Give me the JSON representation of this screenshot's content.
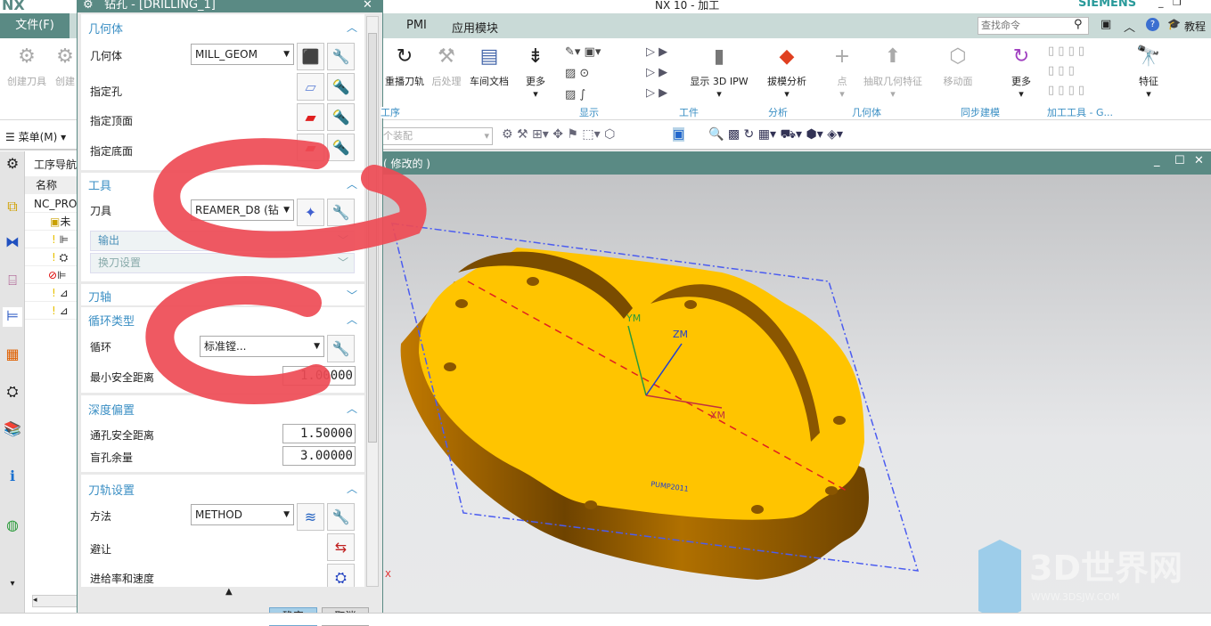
{
  "app": {
    "title": "NX 10 - 加工",
    "brand": "SIEMENS",
    "logo": "NX"
  },
  "menu": {
    "file": "文件(F)",
    "tabs": [
      "PMI",
      "应用模块"
    ],
    "search_placeholder": "查找命令",
    "tutorial": "教程",
    "menu_btn": "菜单(M)"
  },
  "ribbon": {
    "left_buttons": [
      "创建刀具",
      "创建"
    ],
    "buttons": [
      {
        "label": "重播刀轨",
        "icon": "replay-icon",
        "enabled": true
      },
      {
        "label": "后处理",
        "icon": "postprocess-icon",
        "enabled": false
      },
      {
        "label": "车间文档",
        "icon": "shop-doc-icon",
        "enabled": true
      },
      {
        "label": "更多",
        "icon": "more-icon",
        "enabled": true
      },
      {
        "label": "显示 3D IPW",
        "icon": "ipw-icon",
        "enabled": true
      },
      {
        "label": "拔模分析",
        "icon": "draft-analysis-icon",
        "enabled": true
      },
      {
        "label": "点",
        "icon": "point-icon",
        "enabled": false
      },
      {
        "label": "抽取几何特征",
        "icon": "extract-geometry-icon",
        "enabled": false
      },
      {
        "label": "移动面",
        "icon": "move-face-icon",
        "enabled": false
      },
      {
        "label": "更多",
        "icon": "more-icon",
        "enabled": true
      },
      {
        "label": "特征",
        "icon": "feature-icon",
        "enabled": true
      }
    ],
    "groups": [
      "工序",
      "显示",
      "工件",
      "分析",
      "几何体",
      "同步建模",
      "加工工具 - G..."
    ]
  },
  "toolbar": {
    "assembly_placeholder": "个装配"
  },
  "viewport": {
    "title": "( 修改的 )",
    "axes": {
      "x": "XM",
      "y": "YM",
      "z": "ZM"
    },
    "part_text": "PUMP2011",
    "corner_axis": "X",
    "watermark": {
      "name": "3D世界网",
      "url": "WWW.3DSJW.COM"
    }
  },
  "nav": {
    "title": "工序导航",
    "col_name": "名称",
    "root": "NC_PROGRAM",
    "rows": [
      "未",
      "",
      "",
      "",
      ""
    ]
  },
  "dialog": {
    "title": "钻孔 - [DRILLING_1]",
    "sections": {
      "geometry": {
        "title": "几何体",
        "geometry_label": "几何体",
        "geometry_value": "MILL_GEOM",
        "hole": "指定孔",
        "top": "指定顶面",
        "bottom": "指定底面"
      },
      "tool": {
        "title": "工具",
        "tool_label": "刀具",
        "tool_value": "REAMER_D8 (钻",
        "output": "输出",
        "tool_change": "换刀设置"
      },
      "axis": {
        "title": "刀轴"
      },
      "cycle": {
        "title": "循环类型",
        "cycle_label": "循环",
        "cycle_value": "标准镗...",
        "min_clear_label": "最小安全距离",
        "min_clear_value": "1.00000"
      },
      "depth": {
        "title": "深度偏置",
        "through_label": "通孔安全距离",
        "through_value": "1.50000",
        "blind_label": "盲孔余量",
        "blind_value": "3.00000"
      },
      "path": {
        "title": "刀轨设置",
        "method_label": "方法",
        "method_value": "METHOD",
        "avoid": "避让",
        "feeds": "进给率和速度"
      }
    },
    "ok": "确定",
    "cancel": "取消"
  },
  "colors": {
    "teal": "#5a8a84",
    "accent": "#3b8fc4",
    "part": "#ffc400",
    "scribble": "#ee4b55"
  }
}
